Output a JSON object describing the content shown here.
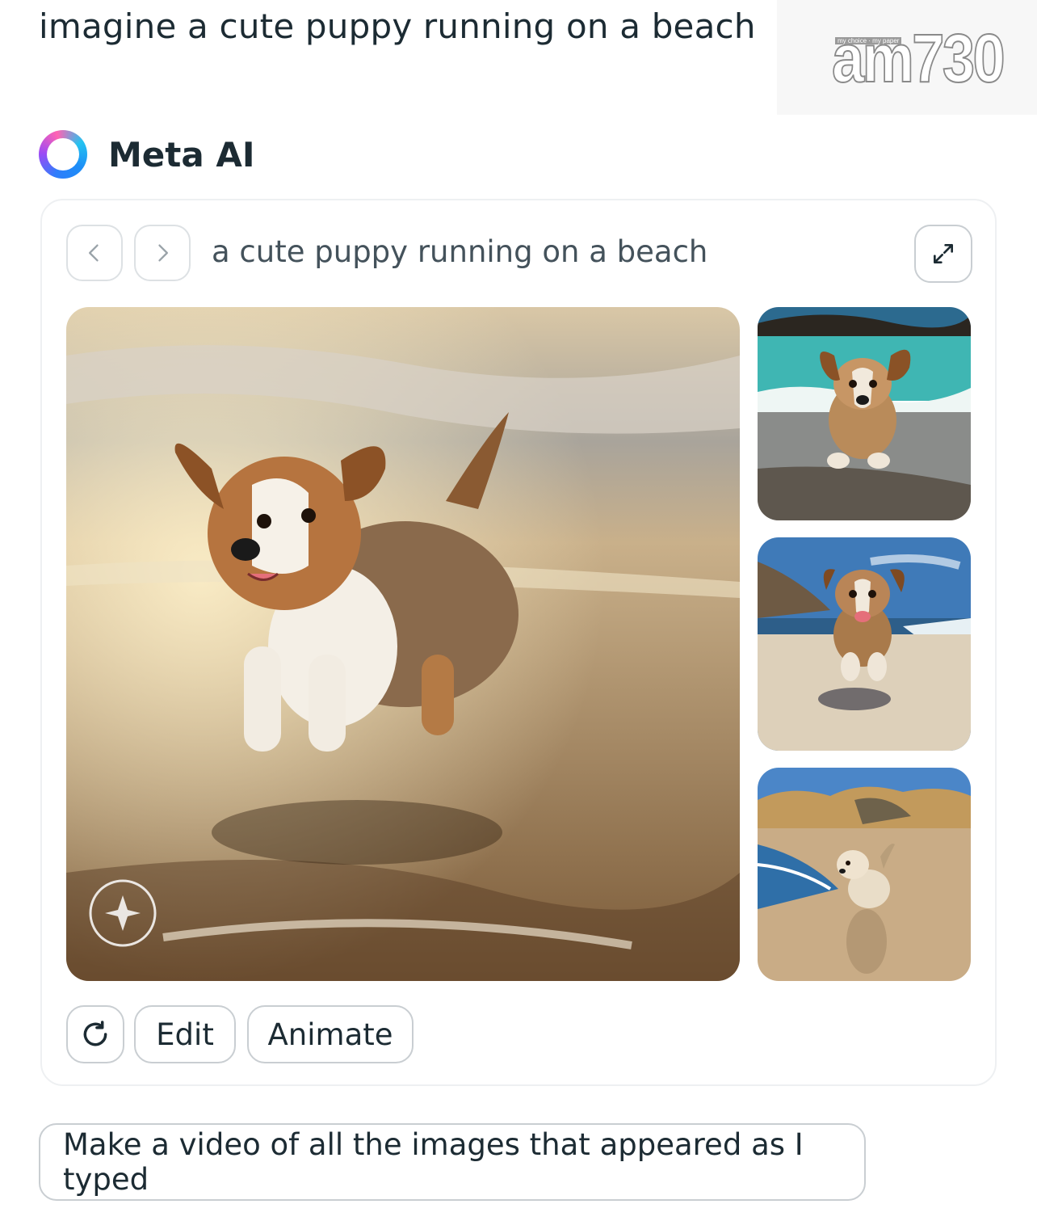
{
  "user_prompt": "imagine a cute puppy running on a beach",
  "watermark": {
    "tagline": "my choice · my paper",
    "logo": "am730"
  },
  "assistant": {
    "name": "Meta AI"
  },
  "card": {
    "title": "a cute puppy running on a beach",
    "nav": {
      "prev_icon": "chevron-left-icon",
      "next_icon": "chevron-right-icon"
    },
    "expand_icon": "expand-icon",
    "images": [
      {
        "role": "main",
        "scene": "golden sunset beach"
      },
      {
        "role": "thumbnail",
        "scene": "turquoise water"
      },
      {
        "role": "thumbnail",
        "scene": "sand dunes blue sky"
      },
      {
        "role": "thumbnail",
        "scene": "grassy dunes shoreline"
      }
    ],
    "actions": {
      "regenerate_icon": "refresh-icon",
      "edit_label": "Edit",
      "animate_label": "Animate"
    }
  },
  "suggestion": "Make a video of all the images that appeared as I typed",
  "colors": {
    "text": "#1c2b33",
    "border": "#c9ced2",
    "muted_text": "#44525b"
  }
}
